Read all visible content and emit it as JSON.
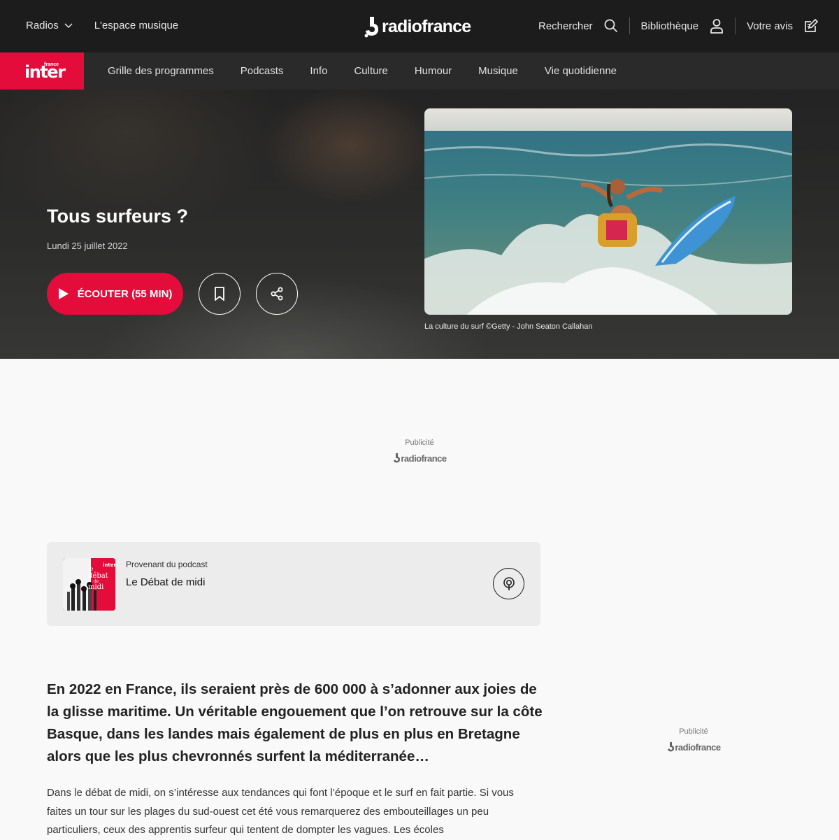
{
  "topbar": {
    "radios_label": "Radios",
    "espace_musique_label": "L'espace musique",
    "brand": "radiofrance",
    "search_label": "Rechercher",
    "library_label": "Bibliothèque",
    "feedback_label": "Votre avis"
  },
  "subnav": {
    "station_small": "france",
    "station_name": "inter",
    "items": [
      {
        "label": "Grille des programmes"
      },
      {
        "label": "Podcasts"
      },
      {
        "label": "Info"
      },
      {
        "label": "Culture"
      },
      {
        "label": "Humour"
      },
      {
        "label": "Musique"
      },
      {
        "label": "Vie quotidienne"
      }
    ]
  },
  "hero": {
    "title": "Tous surfeurs ?",
    "date": "Lundi 25 juillet 2022",
    "listen_label": "ÉCOUTER (55 MIN)",
    "caption": "La culture du surf ©Getty - John Seaton Callahan"
  },
  "ads": [
    {
      "label": "Publicité",
      "brand": "radiofrance"
    },
    {
      "label": "Publicité",
      "brand": "radiofrance"
    }
  ],
  "podcast": {
    "from_label": "Provenant du podcast",
    "name": "Le Débat de midi",
    "thumb_text_1": "le",
    "thumb_text_2": "débat",
    "thumb_text_3": "de",
    "thumb_text_4": "midi",
    "thumb_station": "inter"
  },
  "article": {
    "lead": "En 2022 en France, ils seraient près de 600 000 à s’adonner aux joies de la glisse maritime. Un véritable engouement que l’on retrouve sur la côte Basque, dans les landes mais également de plus en plus en Bretagne alors que les plus chevronnés surfent la méditerranée…",
    "body": "Dans le débat de midi, on s’intéresse aux tendances qui font l’époque et le surf en fait partie. Si vous faites un tour sur les plages du sud-ouest cet été vous remarquerez des embouteillages un peu particuliers, ceux des apprentis surfeur qui tentent de dompter les vagues. Les écoles"
  },
  "colors": {
    "brand_red": "#e30c3b",
    "topbar_bg": "#1c1c1c",
    "subnav_bg": "#2a2a2a"
  }
}
